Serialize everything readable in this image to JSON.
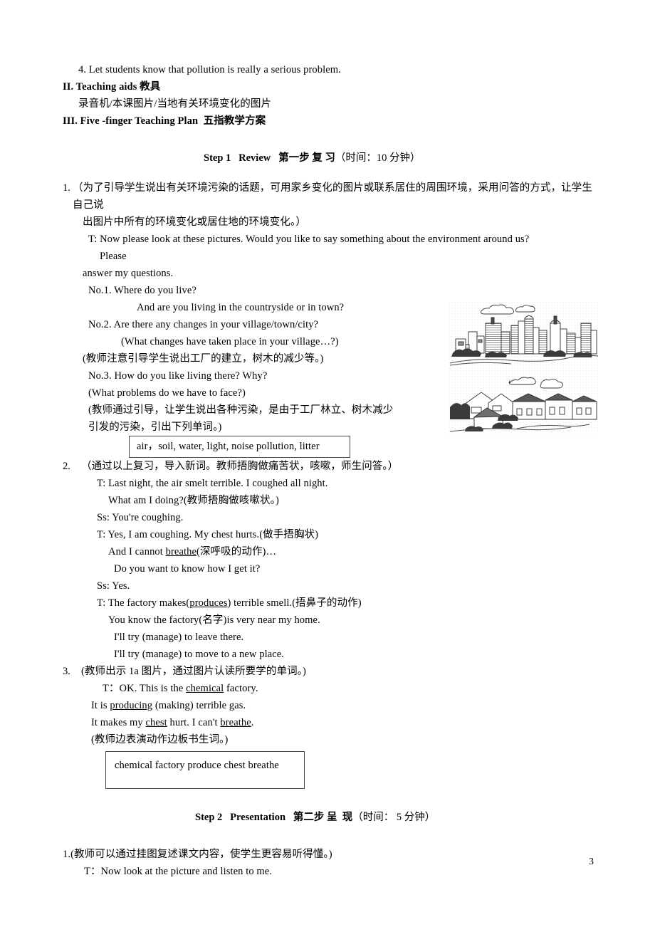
{
  "document": {
    "page_number": "3",
    "lines": {
      "objective_4": "4. Let students know that pollution is really a serious problem.",
      "teaching_aids_heading": "II. Teaching aids 教具",
      "teaching_aids_body": "录音机/本课图片/当地有关环境变化的图片",
      "five_finger_heading": "III. Five -finger Teaching Plan  五指教学方案"
    },
    "step1": {
      "label": "Step 1   Review   第一步 复 习",
      "time": "（时间：10 分钟）",
      "item1": {
        "number": "1.",
        "paren_line_1": "（为了引导学生说出有关环境污染的话题，可用家乡变化的图片或联系居住的周围环境，采用问答的方式，让学生自己说",
        "paren_line_2": "出图片中所有的环境变化或居住地的环境变化。）",
        "t_line_1": "T: Now please look at these pictures. Would you like to say something about the environment around us?",
        "t_line_2": "Please",
        "t_line_3": "answer my questions.",
        "no1": "No.1. Where do you live?",
        "no1_sub": "And are you living in the countryside or in town?",
        "no2": "No.2. Are there any changes in your village/town/city?",
        "no2_sub": "(What changes have taken place in your village…?)",
        "note1": "(教师注意引导学生说出工厂的建立，树木的减少等。)",
        "no3": "No.3. How do you like living there? Why?",
        "no3_sub": "(What problems do we have to face?)",
        "note2_line1": "(教师通过引导，让学生说出各种污染，是由于工厂林立、树木减少",
        "note2_line2": "引发的污染，引出下列单词。)",
        "wordbox": "air，soil, water, light, noise pollution, litter"
      },
      "item2": {
        "number": "2.",
        "paren": "（通过以上复习，导入新词。教师捂胸做痛苦状，咳嗽，师生问答。）",
        "l1": "T: Last night, the air smelt terrible. I coughed all night.",
        "l2": "What am I doing?(教师捂胸做咳嗽状。)",
        "l3": "Ss: You're coughing.",
        "l4": "T: Yes, I am coughing. My chest hurts.(做手捂胸状)",
        "l5_a": "And I cannot ",
        "l5_u": "breathe",
        "l5_b": "(深呼吸的动作)…",
        "l6": "Do you want to know how I get it?",
        "l7": "Ss: Yes.",
        "l8_a": "T: The factory makes(",
        "l8_u": "produces",
        "l8_b": ") terrible smell.(捂鼻子的动作)",
        "l9": "You know the factory(名字)is very near my home.",
        "l10": "I'll try (manage) to leave there.",
        "l11": "I'll try (manage) to move to a new place."
      },
      "item3": {
        "number": "3.",
        "paren": "(教师出示 1a 图片，通过图片认读所要学的单词。)",
        "l1_a": "T：OK. This is the ",
        "l1_u": "chemical",
        "l1_b": " factory.",
        "l2_a": "It is ",
        "l2_u": "producing",
        "l2_b": " (making) terrible gas.",
        "l3_a": "It makes my ",
        "l3_u1": "chest",
        "l3_m": " hurt. I can't ",
        "l3_u2": "breathe",
        "l3_b": ".",
        "l4": "(教师边表演动作边板书生词。)",
        "wordbox": "chemical factory produce chest breathe"
      }
    },
    "step2": {
      "label": "Step 2   Presentation   第二步 呈  现",
      "time": "（时间： 5 分钟）",
      "item1": {
        "number": "1.",
        "paren": "(教师可以通过挂图复述课文内容，使学生更容易听得懂。)",
        "l1": "T：Now look at the picture and listen to me."
      }
    },
    "illustration": {
      "name": "city-and-village-illustration",
      "caption_top": "city skyline",
      "caption_bottom": "village houses"
    }
  }
}
